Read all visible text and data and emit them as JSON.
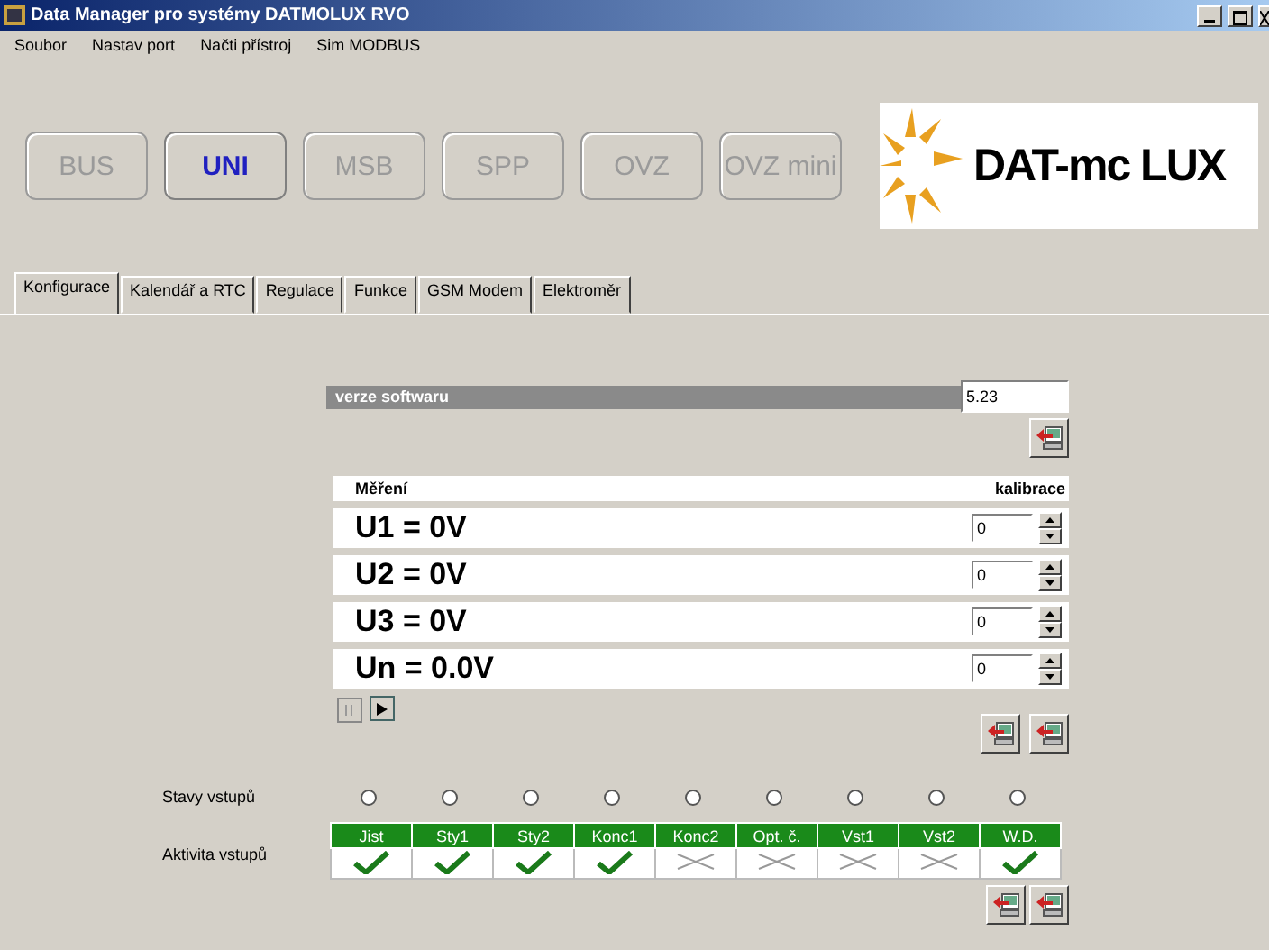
{
  "window": {
    "title": "Data Manager pro systémy DATMOLUX RVO"
  },
  "menu": [
    "Soubor",
    "Nastav port",
    "Načti přístroj",
    "Sim MODBUS"
  ],
  "devices": [
    {
      "label": "BUS",
      "selected": false
    },
    {
      "label": "UNI",
      "selected": true
    },
    {
      "label": "MSB",
      "selected": false
    },
    {
      "label": "SPP",
      "selected": false
    },
    {
      "label": "OVZ",
      "selected": false
    },
    {
      "label": "OVZ mini",
      "selected": false
    }
  ],
  "logo": {
    "text": "DAT-mc LUX"
  },
  "tabs": [
    {
      "label": "Konfigurace",
      "selected": true
    },
    {
      "label": "Kalendář a RTC",
      "selected": false
    },
    {
      "label": "Regulace",
      "selected": false
    },
    {
      "label": "Funkce",
      "selected": false
    },
    {
      "label": "GSM Modem",
      "selected": false
    },
    {
      "label": "Elektroměr",
      "selected": false
    }
  ],
  "software": {
    "label": "verze softwaru",
    "value": "5.23"
  },
  "measurements": {
    "heading": "Měření",
    "calibration_heading": "kalibrace",
    "rows": [
      {
        "reading": "U1 = 0V",
        "calibration": "0"
      },
      {
        "reading": "U2 = 0V",
        "calibration": "0"
      },
      {
        "reading": "U3 = 0V",
        "calibration": "0"
      },
      {
        "reading": "Un = 0.0V",
        "calibration": "0"
      }
    ]
  },
  "input_states_label": "Stavy vstupů",
  "input_activity_label": "Aktivita vstupů",
  "inputs": [
    {
      "name": "Jist",
      "on": false,
      "active": true
    },
    {
      "name": "Sty1",
      "on": false,
      "active": true
    },
    {
      "name": "Sty2",
      "on": false,
      "active": true
    },
    {
      "name": "Konc1",
      "on": false,
      "active": true
    },
    {
      "name": "Konc2",
      "on": false,
      "active": false
    },
    {
      "name": "Opt. č.",
      "on": false,
      "active": false
    },
    {
      "name": "Vst1",
      "on": false,
      "active": false
    },
    {
      "name": "Vst2",
      "on": false,
      "active": false
    },
    {
      "name": "W.D.",
      "on": false,
      "active": true
    }
  ]
}
